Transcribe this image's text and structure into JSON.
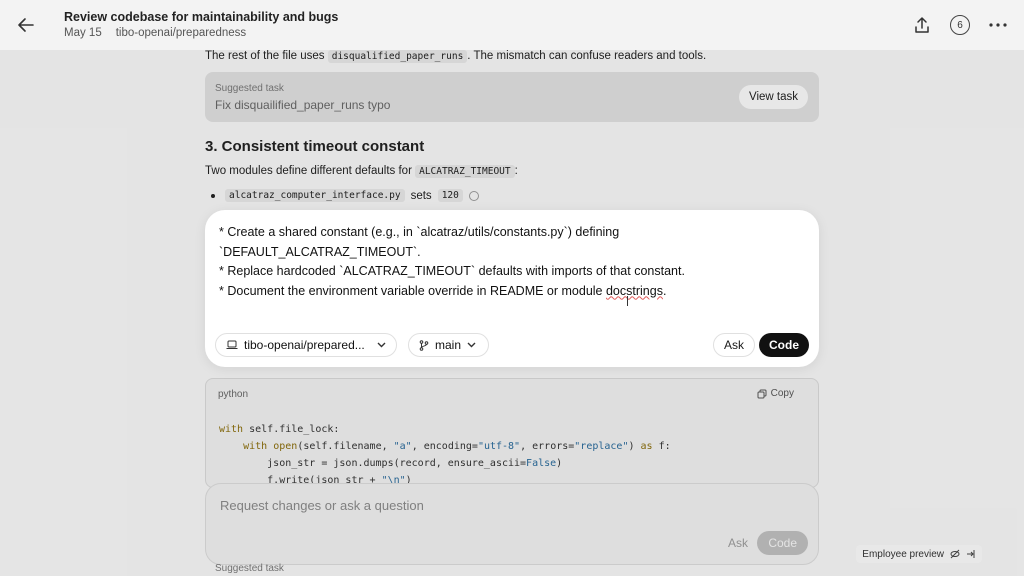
{
  "header": {
    "title": "Review codebase for maintainability and bugs",
    "date": "May 15",
    "repo": "tibo-openai/preparedness",
    "badge_count": "6"
  },
  "content": {
    "para1_prefix": "The rest of the file uses ",
    "para1_code": "disqualified_paper_runs",
    "para1_suffix": ". The mismatch can confuse readers and tools.",
    "task_card": {
      "label": "Suggested task",
      "title": "Fix disquailified_paper_runs typo",
      "button": "View task"
    },
    "heading": "3. Consistent timeout constant",
    "para2_prefix": "Two modules define different defaults for ",
    "para2_code": "ALCATRAZ_TIMEOUT",
    "para2_suffix": ":",
    "bullet1_code": "alcatraz_computer_interface.py",
    "bullet1_text": "sets",
    "bullet1_value": "120"
  },
  "modal": {
    "line1": "* Create a shared constant (e.g., in `alcatraz/utils/constants.py`) defining",
    "line2": "`DEFAULT_ALCATRAZ_TIMEOUT`.",
    "line3": "* Replace hardcoded `ALCATRAZ_TIMEOUT` defaults with imports of that constant.",
    "line4_prefix": "* Document the environment variable override in README or module ",
    "line4_word": "docstrings",
    "line4_suffix": ".",
    "repo_chip": "tibo-openai/prepared...",
    "branch_chip": "main",
    "ask": "Ask",
    "code": "Code"
  },
  "code_block": {
    "lang": "python",
    "copy": "Copy"
  },
  "composer": {
    "placeholder": "Request changes or ask a question",
    "ask": "Ask",
    "code": "Code"
  },
  "footer": {
    "suggested_task": "Suggested task",
    "employee_preview": "Employee preview"
  },
  "colors": {
    "primary": "#111111",
    "background": "#f3f3f3",
    "modal": "#ffffff"
  }
}
